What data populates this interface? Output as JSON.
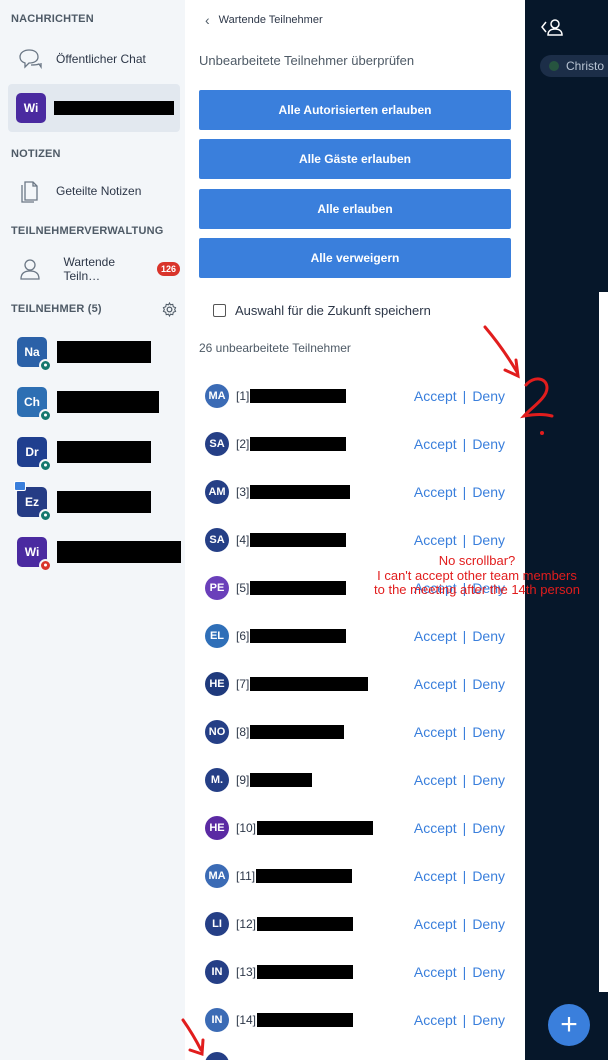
{
  "sidebar": {
    "sections": {
      "messages": "NACHRICHTEN",
      "notes": "NOTIZEN",
      "user_management": "TEILNEHMERVERWALTUNG",
      "participants": "TEILNEHMER (5)"
    },
    "public_chat": "Öffentlicher Chat",
    "private_chat_avatar": "Wi",
    "shared_notes": "Geteilte Notizen",
    "waiting_users": "Wartende Teiln…",
    "waiting_badge": "126",
    "participants": [
      {
        "initials": "Na",
        "color": "#2b61a8",
        "mic": "#14786e",
        "redact_width": 94
      },
      {
        "initials": "Ch",
        "color": "#2d6fb3",
        "mic": "#14786e",
        "redact_width": 102
      },
      {
        "initials": "Dr",
        "color": "#1f3f8f",
        "mic": "#14786e",
        "redact_width": 94
      },
      {
        "initials": "Ez",
        "color": "#253c85",
        "mic": "#14786e",
        "redact_width": 94
      },
      {
        "initials": "Wi",
        "color": "#4a2aa0",
        "mic": "#d9342b",
        "redact_width": 124
      }
    ]
  },
  "panel": {
    "back_label": "Wartende Teilnehmer",
    "subtitle": "Unbearbeitete Teilnehmer überprüfen",
    "btn_allow_authorized": "Alle Autorisierten erlauben",
    "btn_allow_guests": "Alle Gäste erlauben",
    "btn_allow_all": "Alle erlauben",
    "btn_deny_all": "Alle verweigern",
    "remember_choice": "Auswahl für die Zukunft speichern",
    "pending_count": "26 unbearbeitete Teilnehmer",
    "accept_label": "Accept",
    "separator": "|",
    "deny_label": "Deny",
    "waiting": [
      {
        "initials": "MA",
        "label": "[1]",
        "color": "#3b6bb5",
        "redact_width": 96
      },
      {
        "initials": "SA",
        "label": "[2]",
        "color": "#253f86",
        "redact_width": 96
      },
      {
        "initials": "AM",
        "label": "[3]",
        "color": "#253f86",
        "redact_width": 100
      },
      {
        "initials": "SA",
        "label": "[4]",
        "color": "#253f86",
        "redact_width": 96
      },
      {
        "initials": "PE",
        "label": "[5]",
        "color": "#6a3fba",
        "redact_width": 96
      },
      {
        "initials": "EL",
        "label": "[6]",
        "color": "#2f6fb8",
        "redact_width": 96
      },
      {
        "initials": "HE",
        "label": "[7]",
        "color": "#1f3a7c",
        "redact_width": 118
      },
      {
        "initials": "NO",
        "label": "[8]",
        "color": "#253f86",
        "redact_width": 94
      },
      {
        "initials": "M.",
        "label": "[9]",
        "color": "#253f86",
        "redact_width": 62
      },
      {
        "initials": "HE",
        "label": "[10]",
        "color": "#5b2aa3",
        "redact_width": 116
      },
      {
        "initials": "MA",
        "label": "[11]",
        "color": "#3b6bb5",
        "redact_width": 96
      },
      {
        "initials": "LI",
        "label": "[12]",
        "color": "#253f86",
        "redact_width": 96
      },
      {
        "initials": "IN",
        "label": "[13]",
        "color": "#253f86",
        "redact_width": 96
      },
      {
        "initials": "IN",
        "label": "[14]",
        "color": "#3b6bb5",
        "redact_width": 96
      }
    ]
  },
  "right": {
    "presenter_name": "Christo"
  },
  "annotation": {
    "line1": "No scrollbar?",
    "line2": "I can't accept other team members",
    "line3": "to the meeting after the 14th person",
    "mark": "?"
  }
}
